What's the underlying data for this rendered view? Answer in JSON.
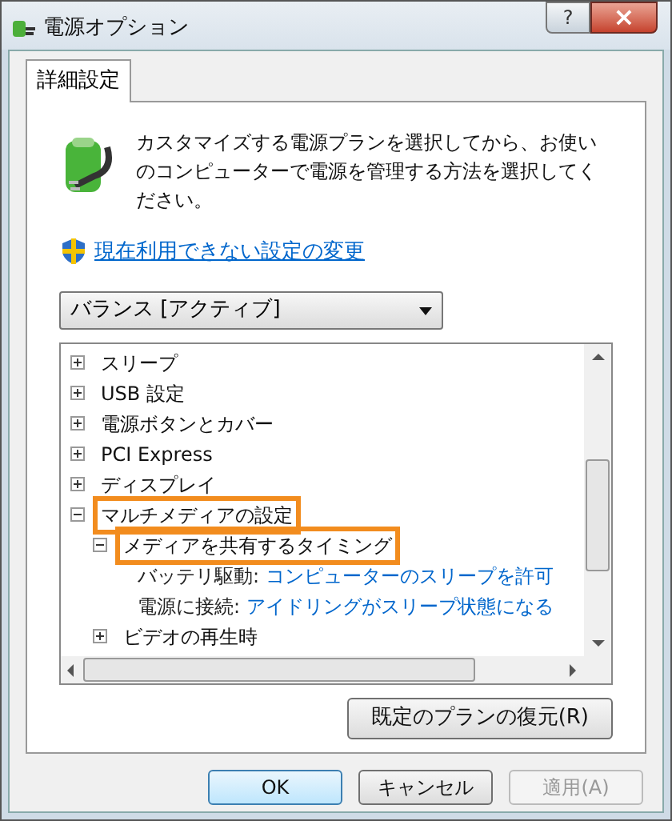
{
  "window": {
    "title": "電源オプション",
    "help": "?",
    "close": "×"
  },
  "tabs": [
    {
      "label": "詳細設定",
      "selected": true
    }
  ],
  "intro": "カスタマイズする電源プランを選択してから、お使いのコンピューターで電源を管理する方法を選択してください。",
  "link": "現在利用できない設定の変更",
  "plan_select": {
    "value": "バランス [アクティブ]"
  },
  "tree": [
    {
      "kind": "group",
      "label": "スリープ",
      "expanded": false,
      "highlighted": false
    },
    {
      "kind": "group",
      "label": "USB 設定",
      "expanded": false,
      "highlighted": false
    },
    {
      "kind": "group",
      "label": "電源ボタンとカバー",
      "expanded": false,
      "highlighted": false
    },
    {
      "kind": "group",
      "label": "PCI Express",
      "expanded": false,
      "highlighted": false
    },
    {
      "kind": "group",
      "label": "ディスプレイ",
      "expanded": false,
      "highlighted": false
    },
    {
      "kind": "group",
      "label": "マルチメディアの設定",
      "expanded": true,
      "highlighted": true,
      "children": [
        {
          "kind": "group",
          "label": "メディアを共有するタイミング",
          "expanded": true,
          "highlighted": true,
          "children": [
            {
              "kind": "setting",
              "label": "バッテリ駆動:",
              "value": "コンピューターのスリープを許可"
            },
            {
              "kind": "setting",
              "label": "電源に接続:",
              "value": "アイドリングがスリープ状態になる"
            }
          ]
        },
        {
          "kind": "group",
          "label": "ビデオの再生時",
          "expanded": false,
          "highlighted": false
        }
      ]
    }
  ],
  "restore_button": "既定のプランの復元(R)",
  "buttons": [
    {
      "label": "OK",
      "default": true,
      "disabled": false
    },
    {
      "label": "キャンセル",
      "default": false,
      "disabled": false
    },
    {
      "label": "適用(A)",
      "default": false,
      "disabled": true
    }
  ]
}
